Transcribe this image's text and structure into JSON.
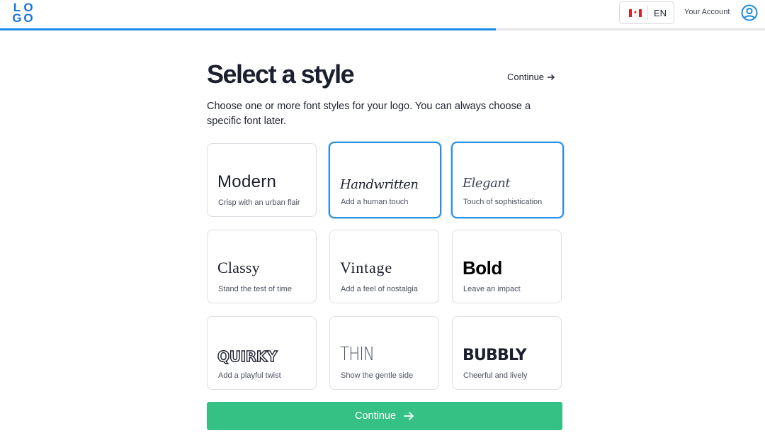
{
  "header": {
    "logo_letters": [
      "L",
      "O",
      "G",
      "O"
    ],
    "language_code": "EN",
    "flag": "canada-flag-icon",
    "account_label": "Your Account"
  },
  "progress": {
    "fraction": 0.648,
    "color": "#1a8be6"
  },
  "main": {
    "title": "Select a style",
    "top_continue_label": "Continue",
    "subtitle": "Choose one or more font styles for your logo. You can always choose a specific font later.",
    "styles": [
      {
        "name": "Modern",
        "description": "Crisp with an urban flair",
        "selected": false
      },
      {
        "name": "Handwritten",
        "description": "Add a human touch",
        "selected": true
      },
      {
        "name": "Elegant",
        "description": "Touch of sophistication",
        "selected": true
      },
      {
        "name": "Classy",
        "description": "Stand the test of time",
        "selected": false
      },
      {
        "name": "Vintage",
        "description": "Add a feel of nostalgia",
        "selected": false
      },
      {
        "name": "Bold",
        "description": "Leave an impact",
        "selected": false
      },
      {
        "name": "QUIRKY",
        "description": "Add a playful twist",
        "selected": false
      },
      {
        "name": "THIN",
        "description": "Show the gentle side",
        "selected": false
      },
      {
        "name": "BUBBLY",
        "description": "Cheerful and lively",
        "selected": false
      }
    ],
    "continue_label": "Continue"
  },
  "colors": {
    "accent": "#2b8fe3",
    "primary_button": "#34c183",
    "brand": "#1a73d9"
  }
}
